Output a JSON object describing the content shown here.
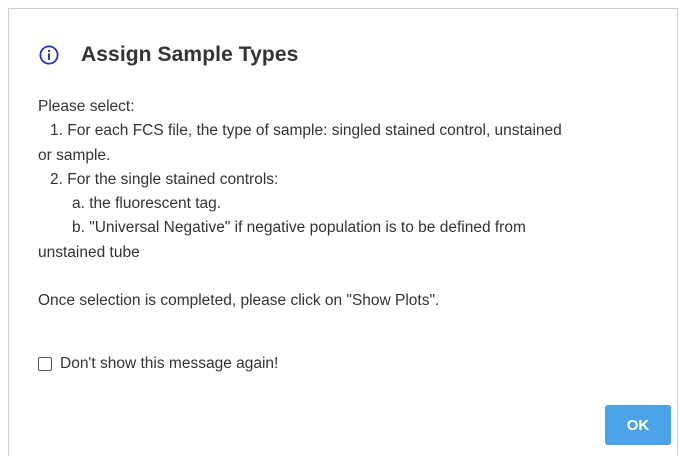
{
  "dialog": {
    "title": "Assign Sample Types",
    "icon": "info-icon",
    "accent_color": "#2b2ec2",
    "lines": {
      "l1": "Please select:",
      "l2": "1. For each FCS file, the type of sample: singled stained control, unstained",
      "l3": "or sample.",
      "l4": "2. For the single stained controls:",
      "l5": "a. the fluorescent tag.",
      "l6": "b. \"Universal Negative\" if negative population is to be defined from",
      "l7": "unstained tube",
      "l8": "Once selection is completed, please click on \"Show Plots\"."
    },
    "checkbox": {
      "label": "Don't show this message again!",
      "checked": false
    },
    "ok_button": {
      "label": "OK",
      "color": "#4da3e8"
    }
  }
}
